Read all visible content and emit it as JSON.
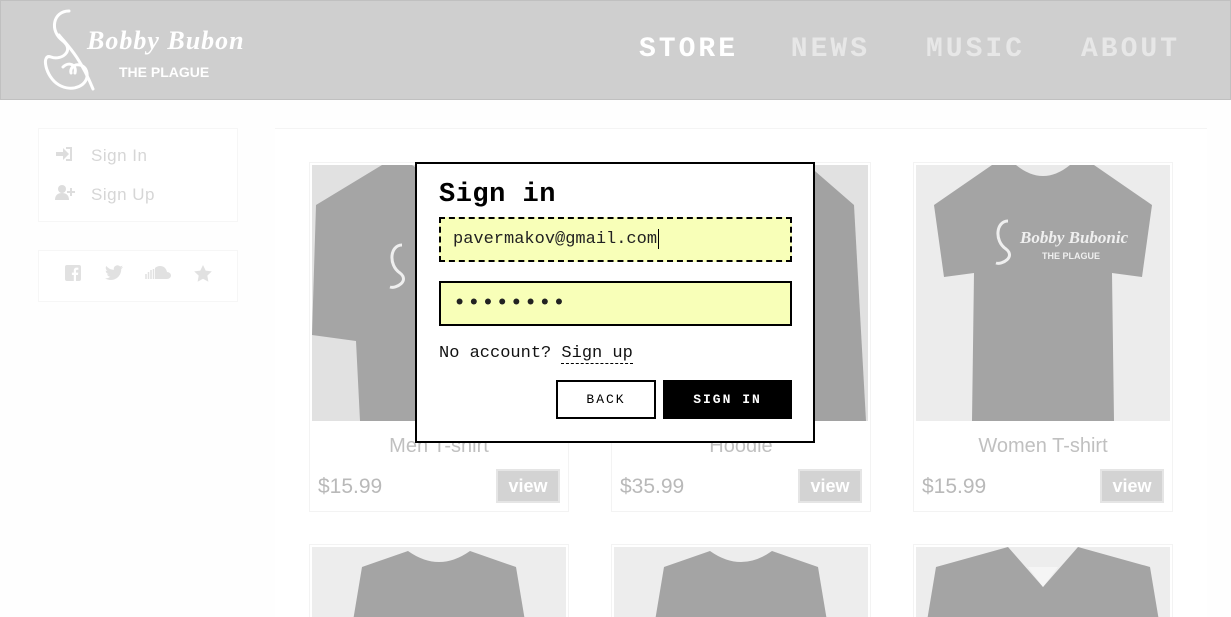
{
  "header": {
    "logo": {
      "name_line1": "Bobby Bubonic",
      "name_line2": "The Plague"
    },
    "nav": [
      {
        "label": "STORE",
        "active": true
      },
      {
        "label": "NEWS",
        "active": false
      },
      {
        "label": "MUSIC",
        "active": false
      },
      {
        "label": "ABOUT",
        "active": false
      }
    ]
  },
  "sidebar": {
    "auth_links": [
      {
        "label": "Sign In",
        "icon": "sign-in-icon"
      },
      {
        "label": "Sign Up",
        "icon": "user-plus-icon"
      }
    ],
    "social": [
      "facebook-icon",
      "twitter-icon",
      "soundcloud-icon",
      "star-icon"
    ]
  },
  "products": [
    {
      "name": "Men T-shirt",
      "price": "$15.99",
      "button": "view"
    },
    {
      "name": "Hoodie",
      "price": "$35.99",
      "button": "view"
    },
    {
      "name": "Women T-shirt",
      "price": "$15.99",
      "button": "view"
    }
  ],
  "dialog": {
    "title": "Sign in",
    "email_value": "pavermakov@gmail.com",
    "password_value": "••••••••",
    "no_account_text": "No account?",
    "signup_link": "Sign up",
    "back_button": "BACK",
    "signin_button": "SIGN IN"
  },
  "colors": {
    "header_bg": "#b2b2b2",
    "field_bg": "#f8ffb8",
    "primary_button": "#000000"
  }
}
